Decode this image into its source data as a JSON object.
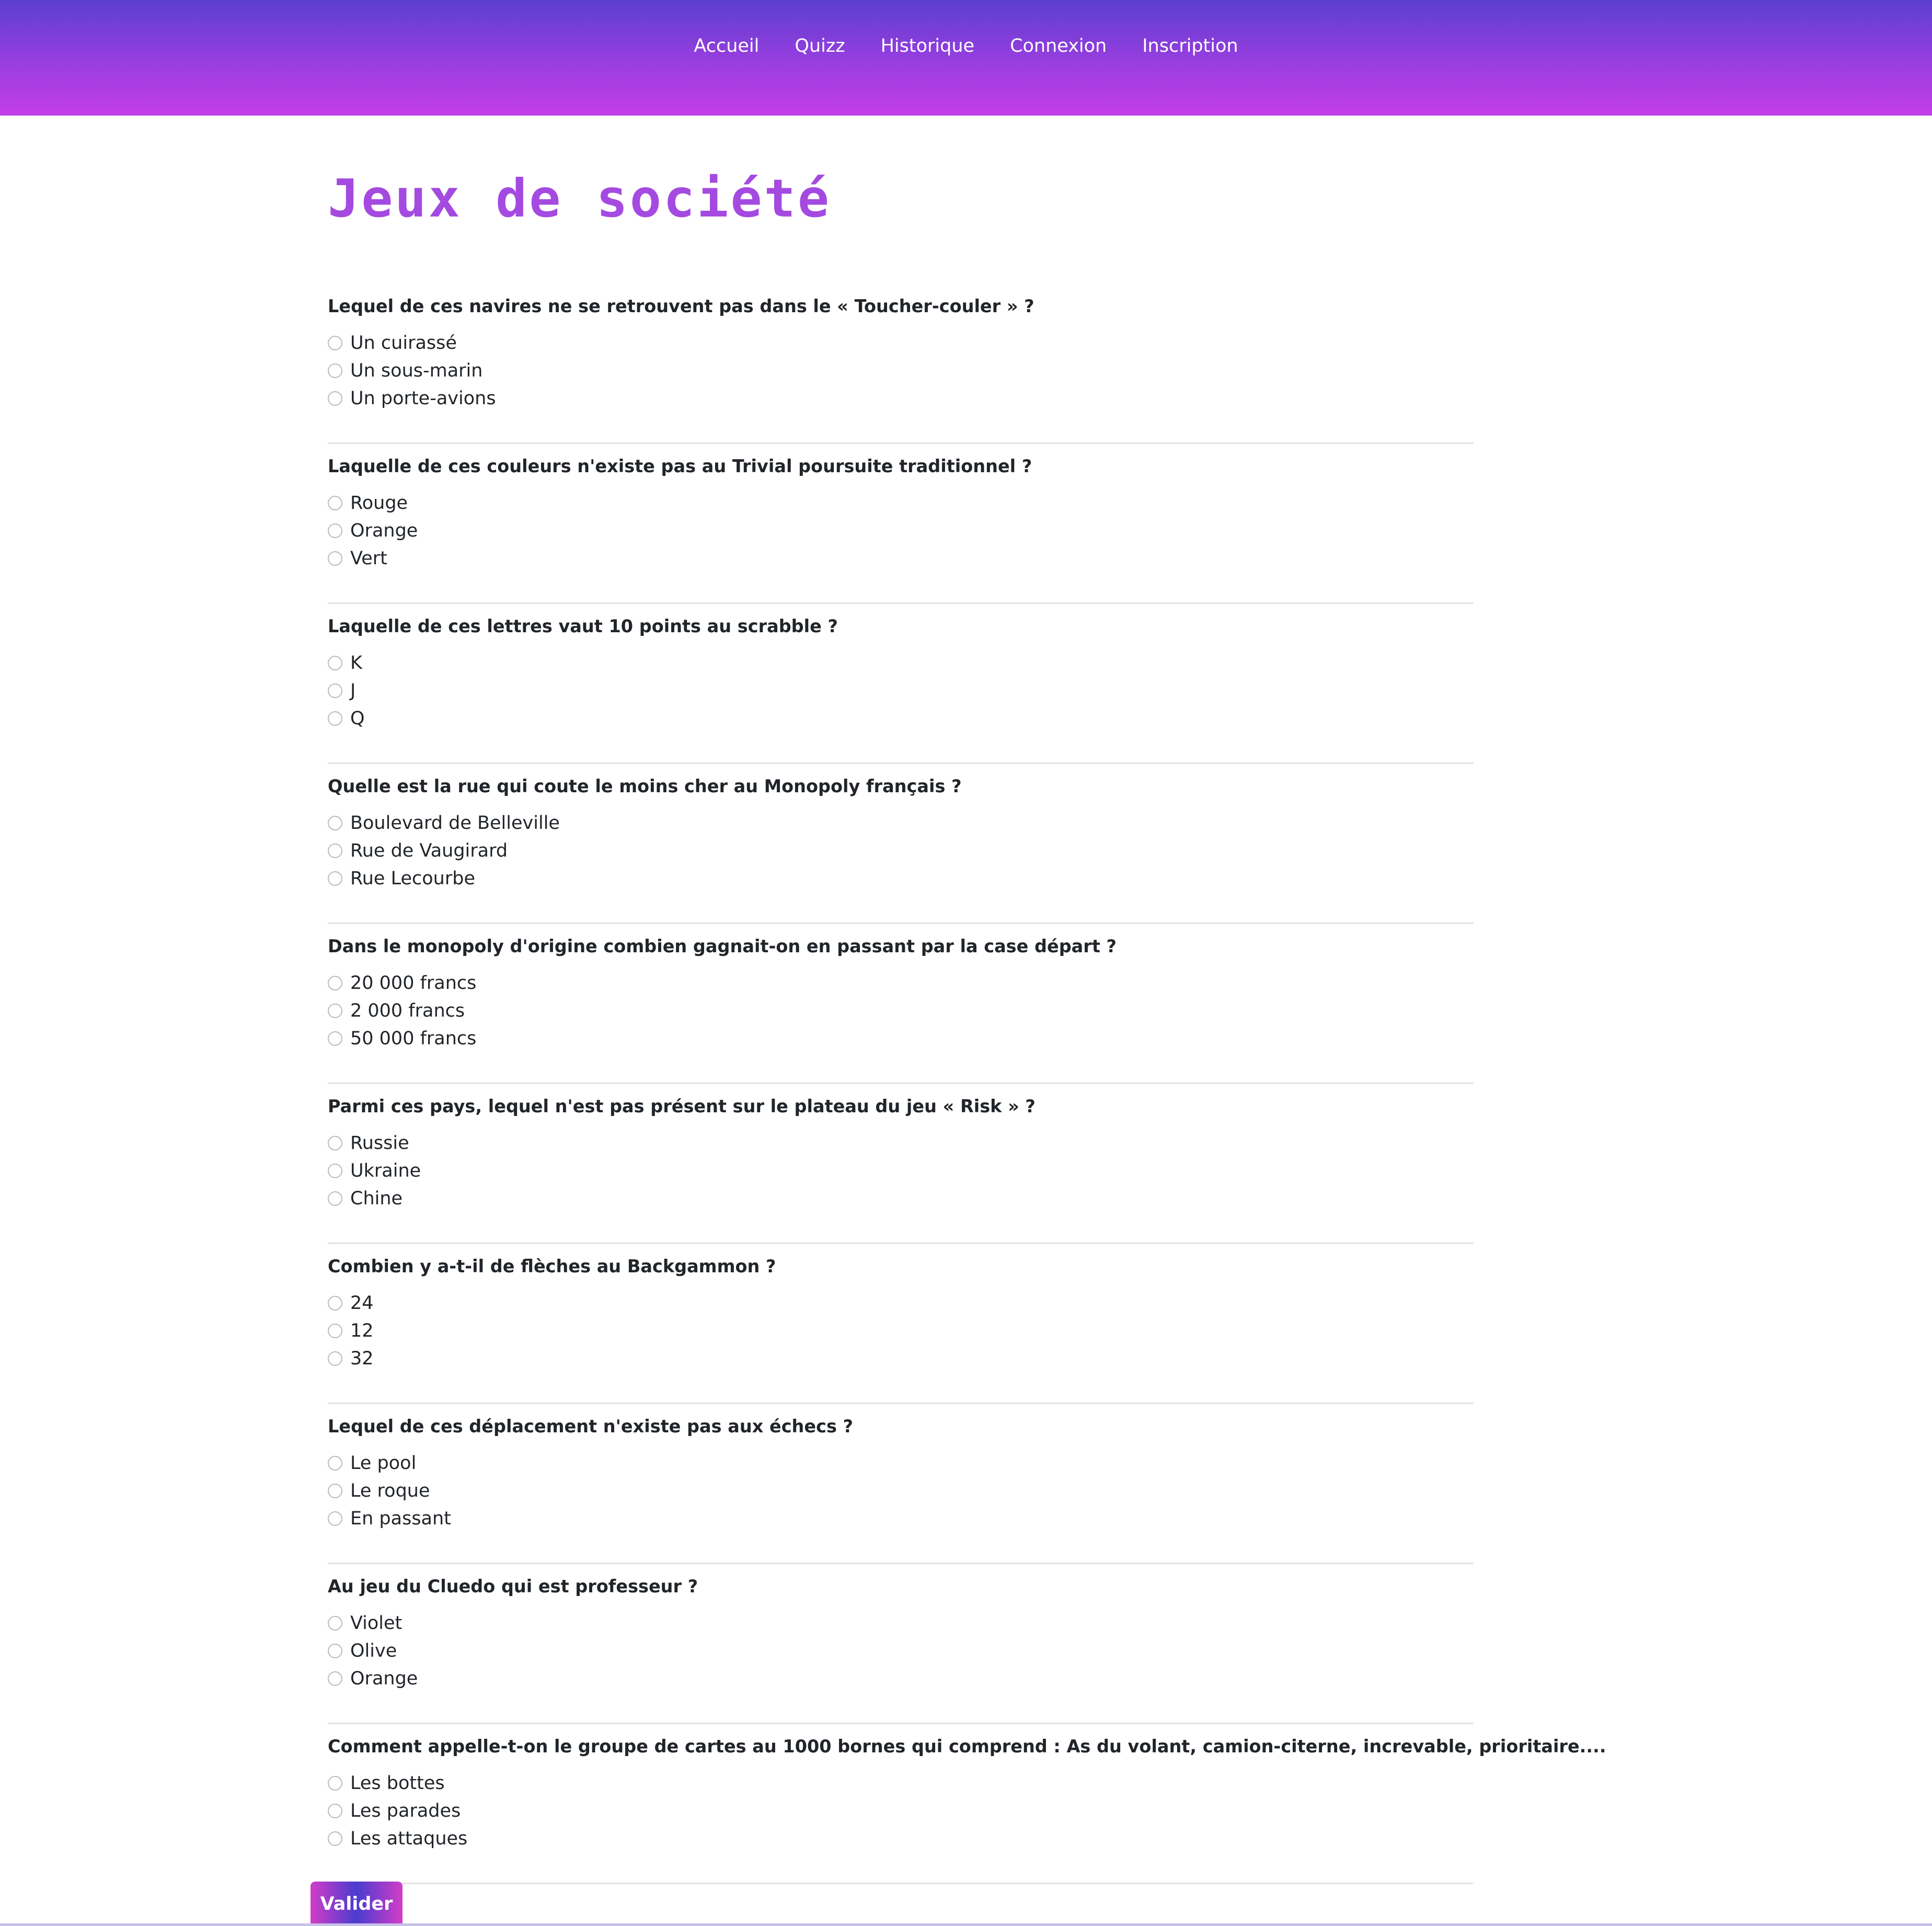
{
  "nav": {
    "items": [
      {
        "label": "Accueil"
      },
      {
        "label": "Quizz"
      },
      {
        "label": "Historique"
      },
      {
        "label": "Connexion"
      },
      {
        "label": "Inscription"
      }
    ]
  },
  "page": {
    "title": "Jeux de société"
  },
  "questions": [
    {
      "text": "Lequel de ces navires ne se retrouvent pas dans le « Toucher-couler » ?",
      "options": [
        "Un cuirassé",
        "Un sous-marin",
        "Un porte-avions"
      ]
    },
    {
      "text": "Laquelle de ces couleurs n'existe pas au Trivial poursuite traditionnel ?",
      "options": [
        "Rouge",
        "Orange",
        "Vert"
      ]
    },
    {
      "text": "Laquelle de ces lettres vaut 10 points au scrabble ?",
      "options": [
        "K",
        "J",
        "Q"
      ]
    },
    {
      "text": "Quelle est la rue qui coute le moins cher au Monopoly français ?",
      "options": [
        "Boulevard de Belleville",
        "Rue de Vaugirard",
        "Rue Lecourbe"
      ]
    },
    {
      "text": "Dans le monopoly d'origine combien gagnait-on en passant par la case départ ?",
      "options": [
        "20 000 francs",
        "2 000 francs",
        "50 000 francs"
      ]
    },
    {
      "text": "Parmi ces pays, lequel n'est pas présent sur le plateau du jeu « Risk » ?",
      "options": [
        "Russie",
        "Ukraine",
        "Chine"
      ]
    },
    {
      "text": "Combien y a-t-il de flèches au Backgammon ?",
      "options": [
        "24",
        "12",
        "32"
      ]
    },
    {
      "text": "Lequel de ces déplacement n'existe pas aux échecs ?",
      "options": [
        "Le pool",
        "Le roque",
        "En passant"
      ]
    },
    {
      "text": "Au jeu du Cluedo qui est professeur ?",
      "options": [
        "Violet",
        "Olive",
        "Orange"
      ]
    },
    {
      "text": "Comment appelle-t-on le groupe de cartes au 1000 bornes qui comprend : As du volant, camion-citerne, increvable, prioritaire....",
      "options": [
        "Les bottes",
        "Les parades",
        "Les attaques"
      ]
    }
  ],
  "form": {
    "submit_label": "Valider"
  },
  "colors": {
    "nav_gradient_top": "#5b3fcf",
    "nav_gradient_bottom": "#c33ee8",
    "title": "#a44ae0",
    "button_pink": "#d23dc7",
    "button_blue": "#4a3ccf"
  }
}
